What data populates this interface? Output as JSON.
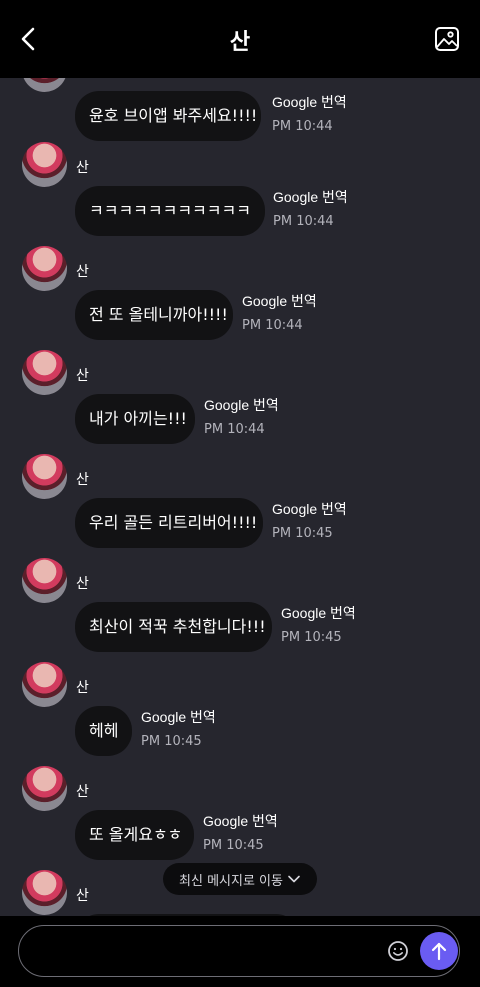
{
  "header": {
    "title": "산"
  },
  "messages": [
    {
      "sender": "",
      "text": "윤호 브이앱 봐주세요!!!!",
      "translate": "Google 번역",
      "time": "PM 10:44"
    },
    {
      "sender": "산",
      "text": "ㅋㅋㅋㅋㅋㅋㅋㅋㅋㅋㅋ",
      "translate": "Google 번역",
      "time": "PM 10:44"
    },
    {
      "sender": "산",
      "text": "전 또 올테니까아!!!!",
      "translate": "Google 번역",
      "time": "PM 10:44"
    },
    {
      "sender": "산",
      "text": "내가 아끼는!!!",
      "translate": "Google 번역",
      "time": "PM 10:44"
    },
    {
      "sender": "산",
      "text": "우리 골든 리트리버어!!!!",
      "translate": "Google 번역",
      "time": "PM 10:45"
    },
    {
      "sender": "산",
      "text": "최산이 적꾹 추천합니다!!!",
      "translate": "Google 번역",
      "time": "PM 10:45"
    },
    {
      "sender": "산",
      "text": "헤헤",
      "translate": "Google 번역",
      "time": "PM 10:45"
    },
    {
      "sender": "산",
      "text": "또 올게요ㅎㅎ",
      "translate": "Google 번역",
      "time": "PM 10:45"
    },
    {
      "sender": "산",
      "text": "",
      "translate": "",
      "time": ""
    }
  ],
  "jump_to_latest": {
    "label": "최신 메시지로 이동"
  },
  "composer": {
    "value": "",
    "placeholder": ""
  },
  "colors": {
    "send_button": "#6a5cf2",
    "bubble": "#121214",
    "background": "#26262e"
  }
}
